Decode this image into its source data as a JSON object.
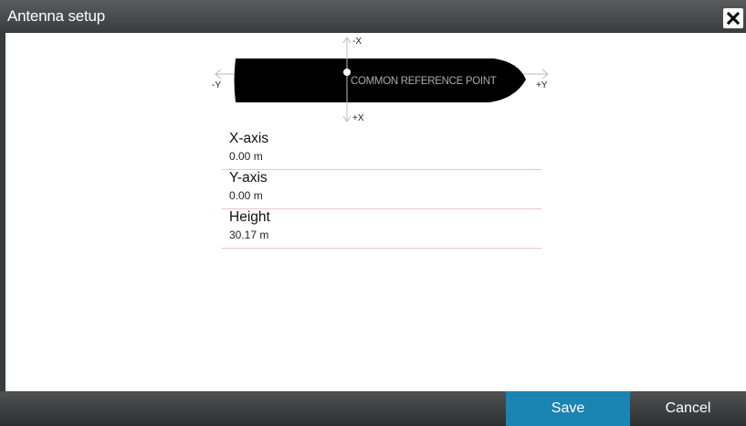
{
  "window": {
    "title": "Antenna setup",
    "close_icon": "close-icon"
  },
  "diagram": {
    "reference_label": "COMMON REFERENCE POINT",
    "axis_labels": {
      "minus_x": "-X",
      "plus_x": "+X",
      "minus_y": "-Y",
      "plus_y": "+Y"
    }
  },
  "fields": [
    {
      "label": "X-axis",
      "value": "0.00 m"
    },
    {
      "label": "Y-axis",
      "value": "0.00 m"
    },
    {
      "label": "Height",
      "value": "30.17 m"
    }
  ],
  "footer": {
    "save_label": "Save",
    "cancel_label": "Cancel"
  },
  "colors": {
    "accent": "#1a84b3",
    "divider": "#e7c8c8",
    "vessel": "#000000"
  }
}
